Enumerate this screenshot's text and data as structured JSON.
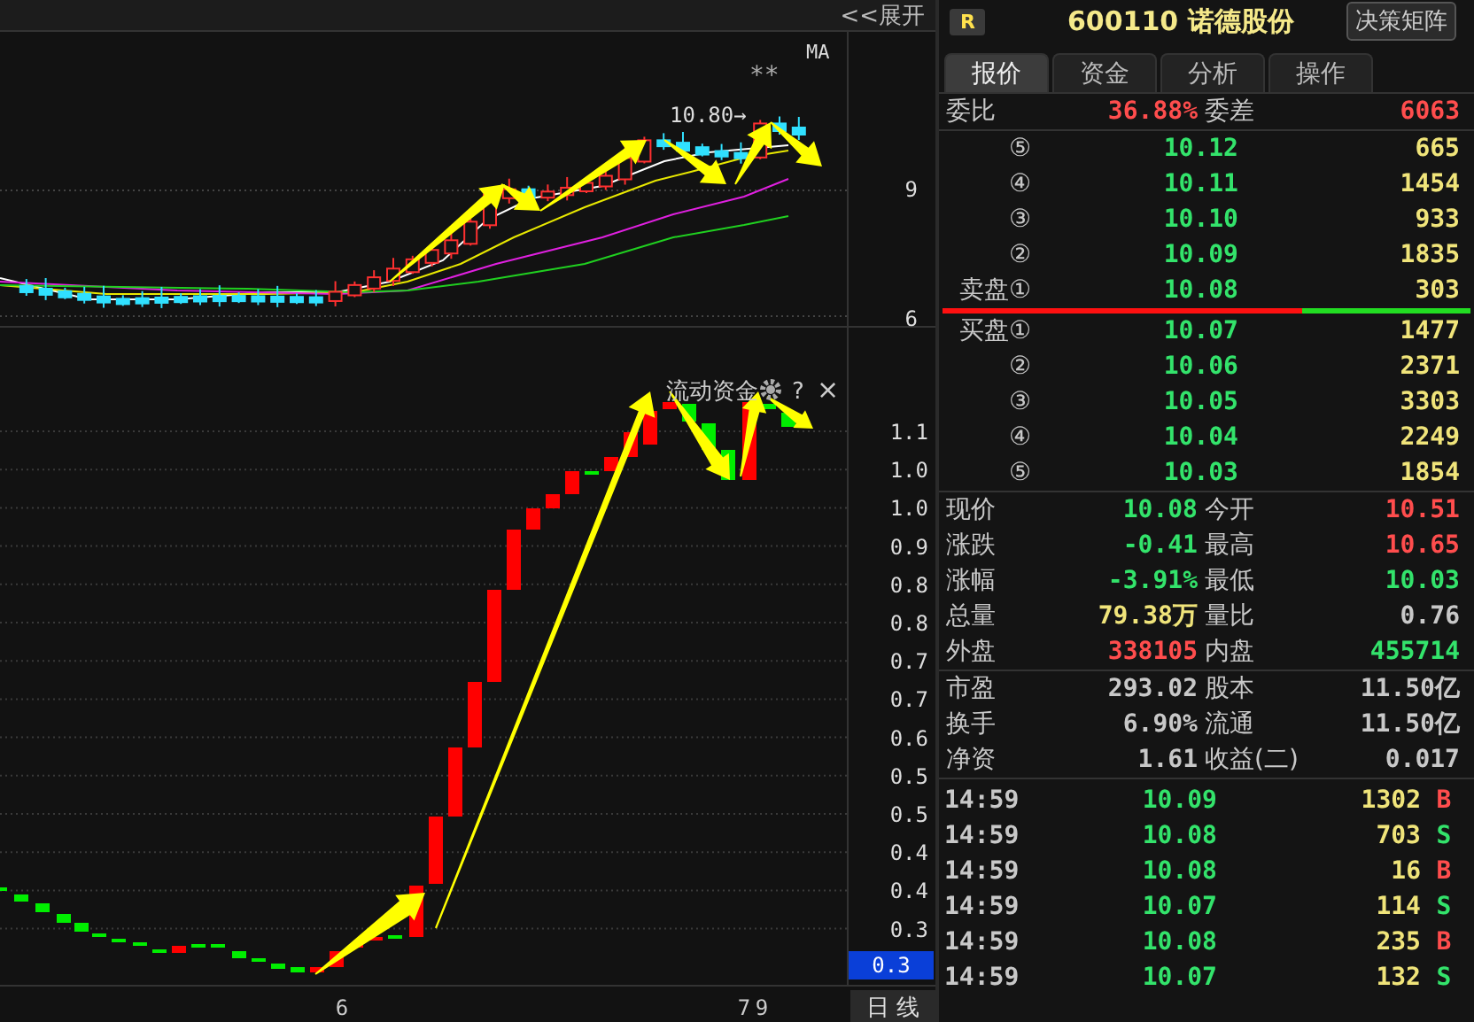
{
  "toolbar": {
    "expand_button": "<<展开"
  },
  "price_chart": {
    "indicator": "MA",
    "marker": "**",
    "high_label": "10.80→",
    "y_axis_labels": [
      "9",
      "6"
    ]
  },
  "fund_chart": {
    "title": "流动资金",
    "help": "?",
    "close": "×",
    "y_axis_labels": [
      "1.1",
      "1.0",
      "1.0",
      "0.9",
      "0.8",
      "0.8",
      "0.7",
      "0.7",
      "0.6",
      "0.5",
      "0.5",
      "0.4",
      "0.4",
      "0.3"
    ],
    "current_value": "0.3"
  },
  "x_axis": {
    "labels": [
      "6",
      "7",
      "9"
    ],
    "period_button": "日 线"
  },
  "quote_panel": {
    "badge": "R",
    "code": "600110",
    "name": "诺德股份",
    "matrix_button": "决策矩阵",
    "tabs": [
      {
        "label": "报价",
        "selected": true
      },
      {
        "label": "资金",
        "selected": false
      },
      {
        "label": "分析",
        "selected": false
      },
      {
        "label": "操作",
        "selected": false
      }
    ],
    "order_ratio": {
      "label": "委比",
      "value": "36.88%",
      "diff_label": "委差",
      "diff": "6063"
    },
    "asks": [
      {
        "label": "⑤",
        "price": "10.12",
        "volume": "665"
      },
      {
        "label": "④",
        "price": "10.11",
        "volume": "1454"
      },
      {
        "label": "③",
        "price": "10.10",
        "volume": "933"
      },
      {
        "label": "②",
        "price": "10.09",
        "volume": "1835"
      },
      {
        "label": "卖盘①",
        "price": "10.08",
        "volume": "303"
      }
    ],
    "bid_ask_bar": {
      "level": 0.68
    },
    "bids": [
      {
        "label": "买盘①",
        "price": "10.07",
        "volume": "1477"
      },
      {
        "label": "②",
        "price": "10.06",
        "volume": "2371"
      },
      {
        "label": "③",
        "price": "10.05",
        "volume": "3303"
      },
      {
        "label": "④",
        "price": "10.04",
        "volume": "2249"
      },
      {
        "label": "⑤",
        "price": "10.03",
        "volume": "1854"
      }
    ],
    "stats": [
      [
        {
          "label": "现价",
          "value": "10.08",
          "color": "#33e36b"
        },
        {
          "label": "今开",
          "value": "10.51",
          "color": "#ff4d4d"
        }
      ],
      [
        {
          "label": "涨跌",
          "value": "-0.41",
          "color": "#33e36b"
        },
        {
          "label": "最高",
          "value": "10.65",
          "color": "#ff4d4d"
        }
      ],
      [
        {
          "label": "涨幅",
          "value": "-3.91%",
          "color": "#33e36b"
        },
        {
          "label": "最低",
          "value": "10.03",
          "color": "#33e36b"
        }
      ],
      [
        {
          "label": "总量",
          "value": "79.38万",
          "color": "#f0e47a"
        },
        {
          "label": "量比",
          "value": "0.76",
          "color": "#c8c8c8"
        }
      ],
      [
        {
          "label": "外盘",
          "value": "338105",
          "color": "#ff4d4d"
        },
        {
          "label": "内盘",
          "value": "455714",
          "color": "#33e36b"
        }
      ]
    ],
    "fundamentals": [
      [
        {
          "label": "市盈",
          "value": "293.02"
        },
        {
          "label": "股本",
          "value": "11.50亿"
        }
      ],
      [
        {
          "label": "换手",
          "value": "6.90%"
        },
        {
          "label": "流通",
          "value": "11.50亿"
        }
      ],
      [
        {
          "label": "净资",
          "value": "1.61"
        },
        {
          "label": "收益(二)",
          "value": "0.017"
        }
      ]
    ],
    "trades": [
      {
        "time": "14:59",
        "price": "10.09",
        "volume": "1302",
        "side": "B",
        "kind": "buy"
      },
      {
        "time": "14:59",
        "price": "10.08",
        "volume": "703",
        "side": "S",
        "kind": "sell"
      },
      {
        "time": "14:59",
        "price": "10.08",
        "volume": "16",
        "side": "B",
        "kind": "buy"
      },
      {
        "time": "14:59",
        "price": "10.07",
        "volume": "114",
        "side": "S",
        "kind": "sell"
      },
      {
        "time": "14:59",
        "price": "10.08",
        "volume": "235",
        "side": "B",
        "kind": "buy"
      },
      {
        "time": "14:59",
        "price": "10.07",
        "volume": "132",
        "side": "S",
        "kind": "sell"
      }
    ]
  }
}
